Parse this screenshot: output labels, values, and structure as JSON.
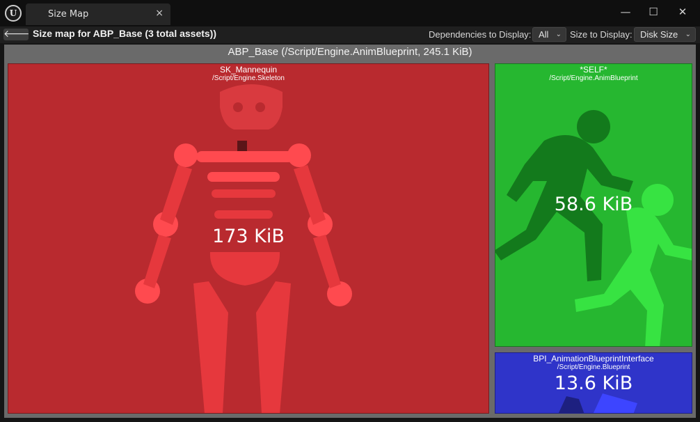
{
  "window": {
    "tab_title": "Size Map",
    "tab_close": "×",
    "minimize": "—",
    "maximize": "☐",
    "close": "✕"
  },
  "toolbar": {
    "back": "🡐",
    "title": "Size map for ABP_Base  (3 total assets))",
    "deps_label": "Dependencies to Display:",
    "deps_value": "All",
    "size_label": "Size to Display:",
    "size_value": "Disk Size",
    "chevron": "⌄"
  },
  "root": {
    "label": "ABP_Base  (/Script/Engine.AnimBlueprint, 245.1 KiB)"
  },
  "nodes": [
    {
      "name": "SK_Mannequin",
      "path": "/Script/Engine.Skeleton",
      "size": "173 KiB",
      "color": "#b92a2f",
      "icon": "skeleton-icon"
    },
    {
      "name": "*SELF*",
      "path": "/Script/Engine.AnimBlueprint",
      "size": "58.6 KiB",
      "color": "#26b730",
      "icon": "running-figures-icon"
    },
    {
      "name": "BPI_AnimationBlueprintInterface",
      "path": "/Script/Engine.Blueprint",
      "size": "13.6 KiB",
      "color": "#2f34c9",
      "icon": "blueprint-icon"
    }
  ]
}
